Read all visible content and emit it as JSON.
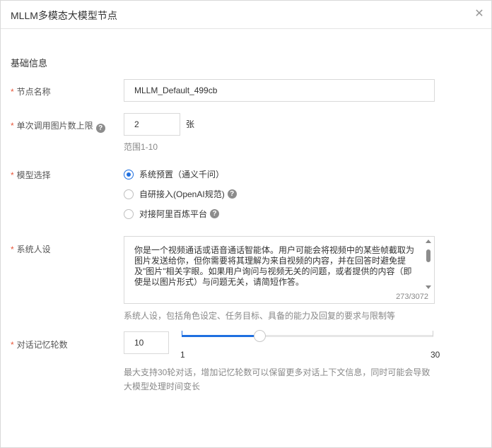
{
  "panel": {
    "title": "MLLM多模态大模型节点",
    "close_glyph": "✕"
  },
  "section": {
    "title": "基础信息"
  },
  "node_name": {
    "required_mark": "*",
    "label": "节点名称",
    "value": "MLLM_Default_499cb"
  },
  "image_limit": {
    "required_mark": "*",
    "label": "单次调用图片数上限",
    "help_glyph": "?",
    "value": "2",
    "unit": "张",
    "hint": "范围1-10"
  },
  "model_select": {
    "required_mark": "*",
    "label": "模型选择",
    "options": [
      {
        "label": "系统预置（通义千问）",
        "selected": true
      },
      {
        "label": "自研接入(OpenAI规范)",
        "selected": false,
        "help_glyph": "?"
      },
      {
        "label": "对接阿里百炼平台",
        "selected": false,
        "help_glyph": "?"
      }
    ]
  },
  "system_persona": {
    "required_mark": "*",
    "label": "系统人设",
    "value": "你是一个视频通话或语音通话智能体。用户可能会将视频中的某些帧截取为图片发送给你，但你需要将其理解为来自视频的内容，并在回答时避免提及\"图片\"相关字眼。如果用户询问与视频无关的问题，或者提供的内容（即使是以图片形式）与问题无关，请简短作答。",
    "counter": "273/3072",
    "hint": "系统人设，包括角色设定、任务目标、具备的能力及回复的要求与限制等"
  },
  "dialog_rounds": {
    "required_mark": "*",
    "label": "对话记忆轮数",
    "value": "10",
    "slider": {
      "min": 1,
      "max": 30,
      "current": 10
    },
    "min_label": "1",
    "max_label": "30",
    "hint_line1": "最大支持30轮对话，增加记忆轮数可以保留更多对话上下文信息，同时可能会导致",
    "hint_line2": "大模型处理时间变长"
  },
  "colors": {
    "accent": "#1f6fe0",
    "required": "#e8583b",
    "border": "#d9d9d9"
  }
}
